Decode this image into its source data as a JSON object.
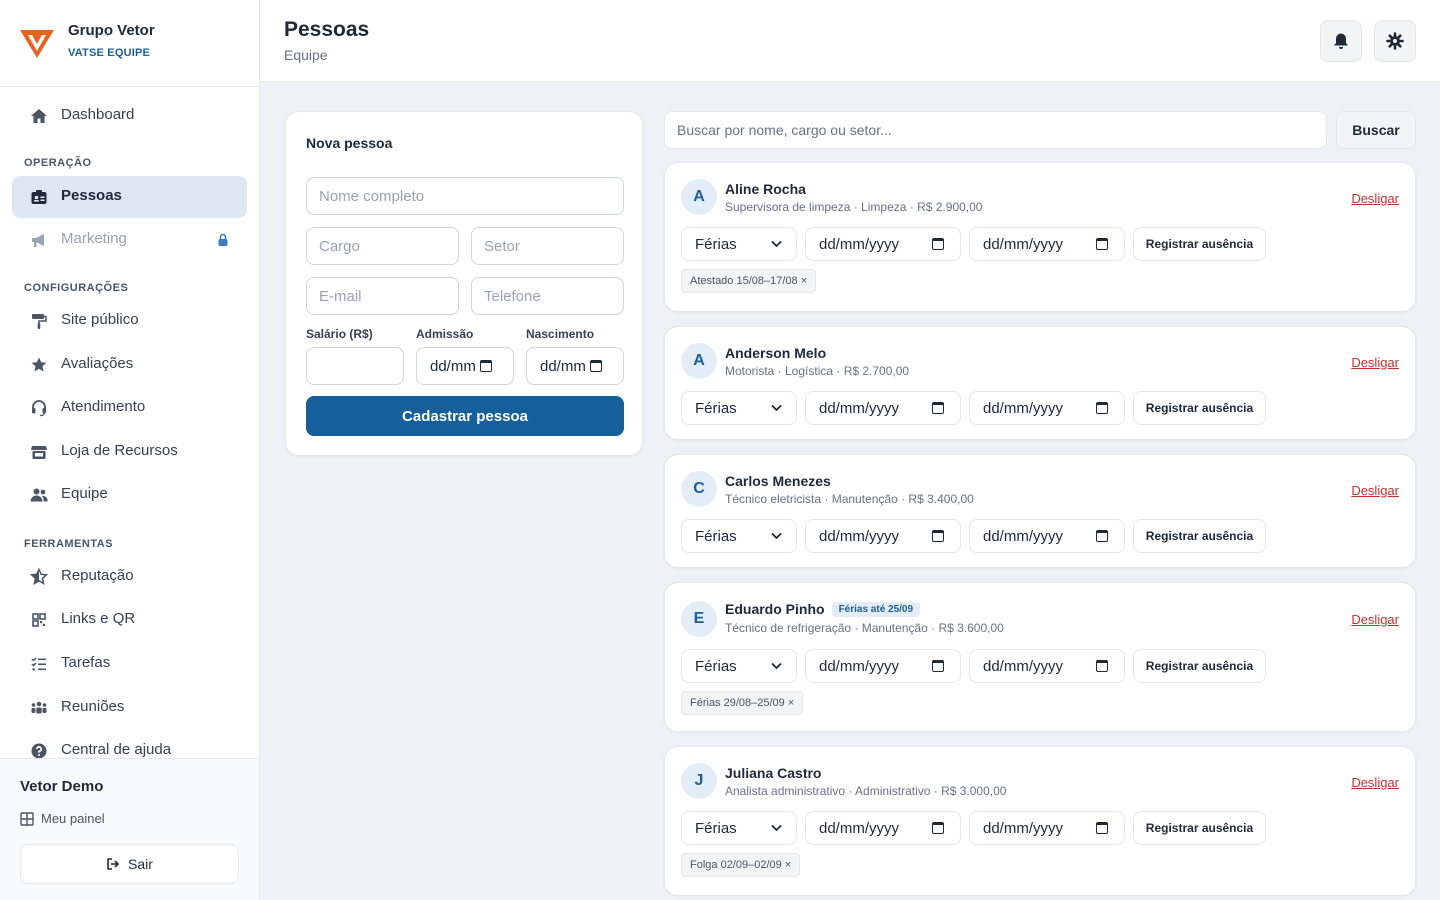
{
  "brand": {
    "name": "Grupo Vetor",
    "subtitle": "VATSE EQUIPE"
  },
  "sidebar": {
    "items": [
      {
        "label": "Dashboard",
        "icon": "home-icon"
      },
      {
        "label": "Pessoas",
        "icon": "id-card-icon",
        "active": true
      },
      {
        "label": "Marketing",
        "icon": "megaphone-icon",
        "locked": true
      },
      {
        "label": "Site público",
        "icon": "paint-roller-icon"
      },
      {
        "label": "Avaliações",
        "icon": "star-icon"
      },
      {
        "label": "Atendimento",
        "icon": "headset-icon"
      },
      {
        "label": "Loja de Recursos",
        "icon": "store-icon"
      },
      {
        "label": "Equipe",
        "icon": "users-icon"
      },
      {
        "label": "Reputação",
        "icon": "star-half-icon"
      },
      {
        "label": "Links e QR",
        "icon": "qr-icon"
      },
      {
        "label": "Tarefas",
        "icon": "list-check-icon"
      },
      {
        "label": "Reuniões",
        "icon": "people-group-icon"
      },
      {
        "label": "Central de ajuda",
        "icon": "help-icon"
      }
    ],
    "sections": {
      "operacao": "OPERAÇÃO",
      "configuracoes": "CONFIGURAÇÕES",
      "ferramentas": "FERRAMENTAS"
    },
    "footer": {
      "user": "Vetor Demo",
      "panel_link": "Meu painel",
      "logout": "Sair"
    }
  },
  "header": {
    "title": "Pessoas",
    "subtitle": "Equipe",
    "bell_icon": "bell-icon",
    "settings_icon": "gear-icon"
  },
  "form": {
    "title": "Nova pessoa",
    "placeholders": {
      "name": "Nome completo",
      "role": "Cargo",
      "sector": "Setor",
      "email": "E-mail",
      "phone": "Telefone"
    },
    "labels": {
      "salary": "Salário (R$)",
      "admission": "Admissão",
      "birth": "Nascimento"
    },
    "date_placeholder_short": "dd/mm",
    "submit": "Cadastrar pessoa"
  },
  "search": {
    "placeholder": "Buscar por nome, cargo ou setor...",
    "button": "Buscar"
  },
  "person_controls": {
    "absence_type": "Férias",
    "date_placeholder": "dd/mm/yyyy",
    "register": "Registrar ausência",
    "dismiss": "Desligar"
  },
  "people": [
    {
      "initial": "A",
      "name": "Aline Rocha",
      "meta": "Supervisora de limpeza · Limpeza · R$ 2.900,00",
      "badge": "",
      "chip": "Atestado 15/08–17/08 ×"
    },
    {
      "initial": "A",
      "name": "Anderson Melo",
      "meta": "Motorista · Logística · R$ 2.700,00",
      "badge": "",
      "chip": ""
    },
    {
      "initial": "C",
      "name": "Carlos Menezes",
      "meta": "Técnico eletricista · Manutenção · R$ 3.400,00",
      "badge": "",
      "chip": ""
    },
    {
      "initial": "E",
      "name": "Eduardo Pinho",
      "meta": "Técnico de refrigeração · Manutenção · R$ 3.600,00",
      "badge": "Férias até 25/09",
      "chip": "Férias 29/08–25/09 ×"
    },
    {
      "initial": "J",
      "name": "Juliana Castro",
      "meta": "Analista administrativo · Administrativo · R$ 3.000,00",
      "badge": "",
      "chip": "Folga 02/09–02/09 ×"
    }
  ],
  "colors": {
    "primary": "#15609a",
    "accent_orange": "#e8641e",
    "danger": "#c53030",
    "active_bg": "#dbe8f4"
  }
}
